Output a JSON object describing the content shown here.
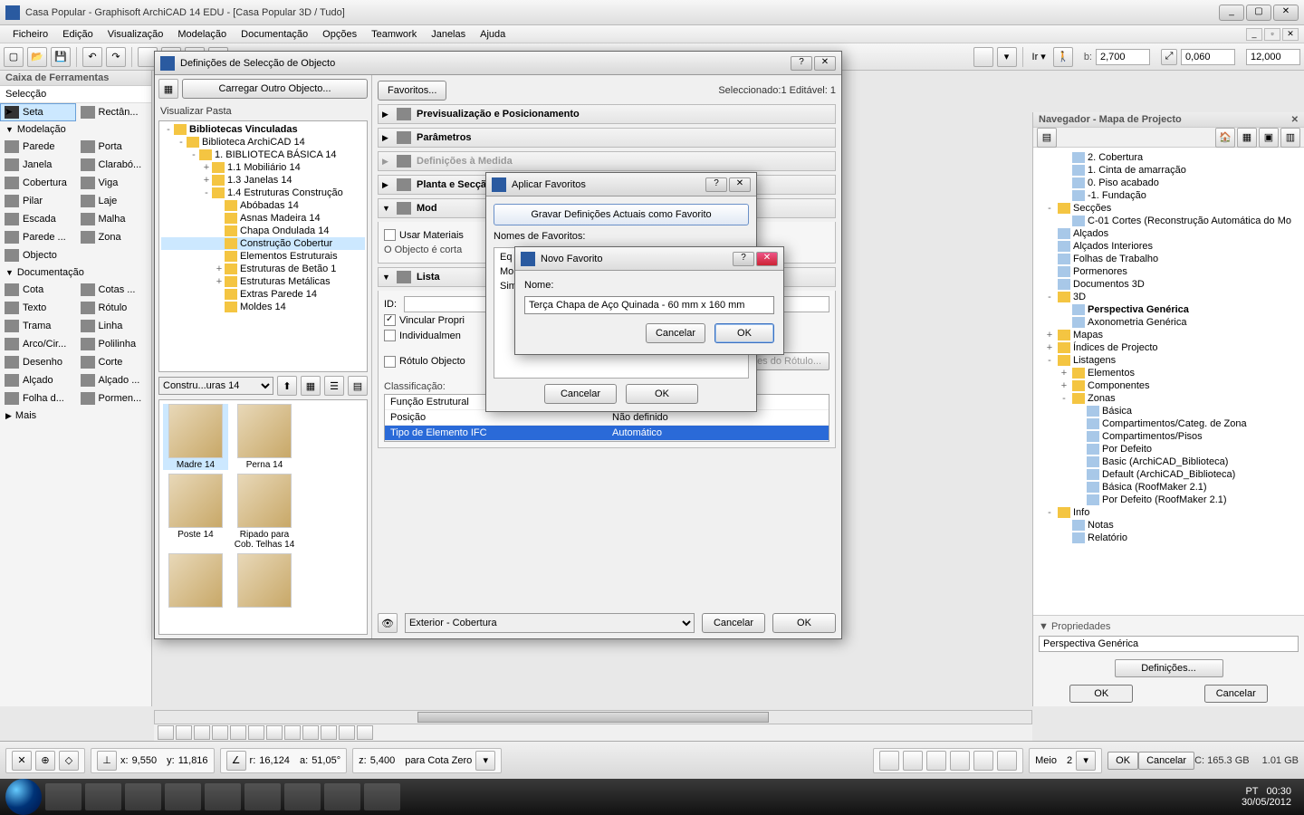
{
  "titlebar": {
    "title": "Casa Popular - Graphisoft ArchiCAD 14 EDU - [Casa Popular 3D / Tudo]"
  },
  "menu": [
    "Ficheiro",
    "Edição",
    "Visualização",
    "Modelação",
    "Documentação",
    "Opções",
    "Teamwork",
    "Janelas",
    "Ajuda"
  ],
  "infobar": {
    "b_label": "b:",
    "b_value": "2,700",
    "h1_value": "0,060",
    "h2_value": "12,000"
  },
  "toolbox": {
    "title": "Caixa de Ferramentas",
    "selection": "Selecção",
    "arrow": "Seta",
    "rect": "Rectân...",
    "sect_model": "Modelação",
    "items_model": [
      [
        "Parede",
        "Porta"
      ],
      [
        "Janela",
        "Clarabó..."
      ],
      [
        "Cobertura",
        "Viga"
      ],
      [
        "Pilar",
        "Laje"
      ],
      [
        "Escada",
        "Malha"
      ],
      [
        "Parede ...",
        "Zona"
      ],
      [
        "Objecto",
        ""
      ]
    ],
    "sect_doc": "Documentação",
    "items_doc": [
      [
        "Cota",
        "Cotas ..."
      ],
      [
        "Texto",
        "Rótulo"
      ],
      [
        "Trama",
        "Linha"
      ],
      [
        "Arco/Cir...",
        "Polilinha"
      ],
      [
        "Desenho",
        "Corte"
      ],
      [
        "Alçado",
        "Alçado ..."
      ],
      [
        "Folha d...",
        "Pormen..."
      ]
    ],
    "more": "Mais"
  },
  "navigator": {
    "title": "Navegador - Mapa de Projecto",
    "tree": [
      {
        "indent": 1,
        "label": "2. Cobertura"
      },
      {
        "indent": 1,
        "label": "1. Cinta de amarração"
      },
      {
        "indent": 1,
        "label": "0. Piso acabado"
      },
      {
        "indent": 1,
        "label": "-1. Fundação"
      },
      {
        "indent": 0,
        "ex": "-",
        "label": "Secções"
      },
      {
        "indent": 1,
        "label": "C-01 Cortes (Reconstrução Automática do Mo"
      },
      {
        "indent": 0,
        "label": "Alçados"
      },
      {
        "indent": 0,
        "label": "Alçados Interiores"
      },
      {
        "indent": 0,
        "label": "Folhas de Trabalho"
      },
      {
        "indent": 0,
        "label": "Pormenores"
      },
      {
        "indent": 0,
        "label": "Documentos 3D"
      },
      {
        "indent": 0,
        "ex": "-",
        "label": "3D"
      },
      {
        "indent": 1,
        "sel": true,
        "label": "Perspectiva Genérica"
      },
      {
        "indent": 1,
        "label": "Axonometria Genérica"
      },
      {
        "indent": 0,
        "ex": "+",
        "label": "Mapas"
      },
      {
        "indent": 0,
        "ex": "+",
        "label": "Índices de Projecto"
      },
      {
        "indent": 0,
        "ex": "-",
        "label": "Listagens"
      },
      {
        "indent": 1,
        "ex": "+",
        "label": "Elementos"
      },
      {
        "indent": 1,
        "ex": "+",
        "label": "Componentes"
      },
      {
        "indent": 1,
        "ex": "-",
        "label": "Zonas"
      },
      {
        "indent": 2,
        "label": "Básica"
      },
      {
        "indent": 2,
        "label": "Compartimentos/Categ. de Zona"
      },
      {
        "indent": 2,
        "label": "Compartimentos/Pisos"
      },
      {
        "indent": 2,
        "label": "Por Defeito"
      },
      {
        "indent": 2,
        "label": "Basic (ArchiCAD_Biblioteca)"
      },
      {
        "indent": 2,
        "label": "Default (ArchiCAD_Biblioteca)"
      },
      {
        "indent": 2,
        "label": "Básica (RoofMaker 2.1)"
      },
      {
        "indent": 2,
        "label": "Por Defeito (RoofMaker 2.1)"
      },
      {
        "indent": 0,
        "ex": "-",
        "label": "Info"
      },
      {
        "indent": 1,
        "label": "Notas"
      },
      {
        "indent": 1,
        "label": "Relatório"
      }
    ],
    "prop_title": "Propriedades",
    "prop_name": "Perspectiva Genérica",
    "btn_def": "Definições...",
    "btn_ok": "OK",
    "btn_cancel": "Cancelar"
  },
  "objdlg": {
    "title": "Definições de Selecção de Objecto",
    "load_btn": "Carregar Outro Objecto...",
    "fold_label": "Visualizar Pasta",
    "libtree": [
      {
        "ind": 0,
        "ex": "-",
        "lbl": "Bibliotecas Vinculadas",
        "b": true
      },
      {
        "ind": 1,
        "ex": "-",
        "lbl": "Biblioteca ArchiCAD 14"
      },
      {
        "ind": 2,
        "ex": "-",
        "lbl": "1. BIBLIOTECA BÁSICA 14"
      },
      {
        "ind": 3,
        "ex": "+",
        "lbl": "1.1 Mobiliário 14"
      },
      {
        "ind": 3,
        "ex": "+",
        "lbl": "1.3 Janelas 14"
      },
      {
        "ind": 3,
        "ex": "-",
        "lbl": "1.4 Estruturas Construção"
      },
      {
        "ind": 4,
        "lbl": "Abóbadas 14"
      },
      {
        "ind": 4,
        "lbl": "Asnas Madeira 14"
      },
      {
        "ind": 4,
        "lbl": "Chapa Ondulada 14"
      },
      {
        "ind": 4,
        "sel": true,
        "lbl": "Construção Cobertur"
      },
      {
        "ind": 4,
        "lbl": "Elementos Estruturais"
      },
      {
        "ind": 4,
        "ex": "+",
        "lbl": "Estruturas de Betão 1"
      },
      {
        "ind": 4,
        "ex": "+",
        "lbl": "Estruturas Metálicas"
      },
      {
        "ind": 4,
        "lbl": "Extras Parede 14"
      },
      {
        "ind": 4,
        "lbl": "Moldes 14"
      }
    ],
    "folder_sel": "Constru...uras 14",
    "thumbs": [
      "Madre 14",
      "Perna 14",
      "Poste 14",
      "Ripado para Cob. Telhas 14",
      "",
      ""
    ],
    "fav_btn": "Favoritos...",
    "sel_info": "Seleccionado:1 Editável: 1",
    "panels": {
      "preview": "Previsualização e Posicionamento",
      "params": "Parâmetros",
      "custom": "Definições à Medida",
      "plan": "Planta e Secção",
      "model": "Mod",
      "listing": "Lista"
    },
    "chk_materials": "Usar Materiais",
    "obj_cut_note": "O Objecto é corta",
    "id_label": "ID:",
    "chk_link": "Vincular Propri",
    "chk_indiv": "Individualmen",
    "chk_label": "Rótulo Objecto",
    "btn_label_def": "Definições do Rótulo...",
    "class_hdr": "Classificação:",
    "class_rows": [
      [
        "Função Estrutural",
        "Elemento Estrutural"
      ],
      [
        "Posição",
        "Não definido"
      ],
      [
        "Tipo de Elemento IFC",
        "Automático"
      ]
    ],
    "layer": "Exterior - Cobertura",
    "btn_cancel": "Cancelar",
    "btn_ok": "OK"
  },
  "favdlg": {
    "title": "Aplicar Favoritos",
    "save_btn": "Gravar Definições Actuais como Favorito",
    "list_label": "Nomes de Favoritos:",
    "rows": [
      "Eq",
      "Mob",
      "Sim"
    ],
    "btn_cancel": "Cancelar",
    "btn_ok": "OK"
  },
  "newdlg": {
    "title": "Novo Favorito",
    "name_label": "Nome:",
    "name_value": "Terça Chapa de Aço Quinada - 60 mm x 160 mm",
    "btn_cancel": "Cancelar",
    "btn_ok": "OK"
  },
  "coords": {
    "x_label": "x:",
    "x": "9,550",
    "y_label": "y:",
    "y": "11,816",
    "r_label": "r:",
    "r": "16,124",
    "a_label": "a:",
    "a": "51,05°",
    "z_label": "z:",
    "z": "5,400",
    "zref": "para Cota Zero",
    "meio_label": "Meio",
    "meio_val": "2",
    "btn_ok": "OK",
    "btn_cancel": "Cancelar"
  },
  "status": {
    "disk_c": "C: 165.3 GB",
    "disk_d": "1.01 GB",
    "lang": "PT",
    "time": "00:30",
    "date": "30/05/2012"
  }
}
